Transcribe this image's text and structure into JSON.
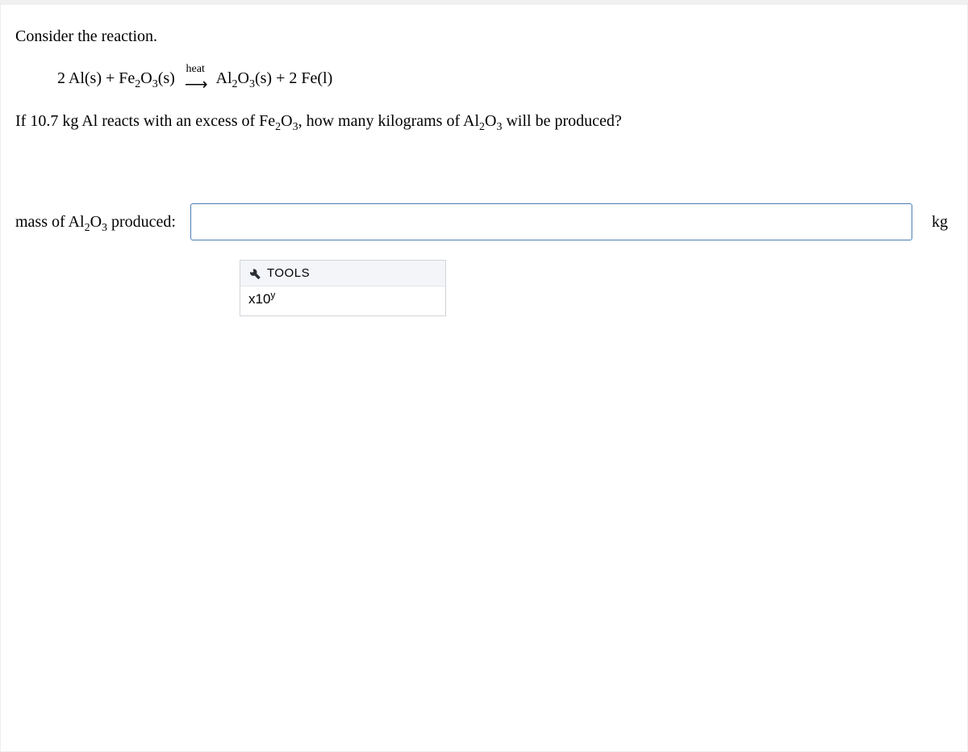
{
  "problem": {
    "intro": "Consider the reaction.",
    "eq_lhs_pre": "2 Al(s) + Fe",
    "eq_lhs_sub1": "2",
    "eq_lhs_mid1": "O",
    "eq_lhs_sub2": "3",
    "eq_lhs_post": "(s)",
    "arrow_label": "heat",
    "arrow_glyph": "⟶",
    "eq_rhs_pre": "Al",
    "eq_rhs_sub1": "2",
    "eq_rhs_mid1": "O",
    "eq_rhs_sub2": "3",
    "eq_rhs_post": "(s) + 2 Fe(l)",
    "question_pre": "If 10.7 kg Al reacts with an excess of Fe",
    "question_sub1": "2",
    "question_mid1": "O",
    "question_sub2": "3",
    "question_mid2": ", how many kilograms of Al",
    "question_sub3": "2",
    "question_mid3": "O",
    "question_sub4": "3",
    "question_post": " will be produced?"
  },
  "answer": {
    "label_pre": "mass of Al",
    "label_sub1": "2",
    "label_mid1": "O",
    "label_sub2": "3",
    "label_post": " produced:",
    "value": "",
    "unit": "kg"
  },
  "tools": {
    "header": "TOOLS",
    "sci_base": "x10",
    "sci_exp": "y"
  }
}
